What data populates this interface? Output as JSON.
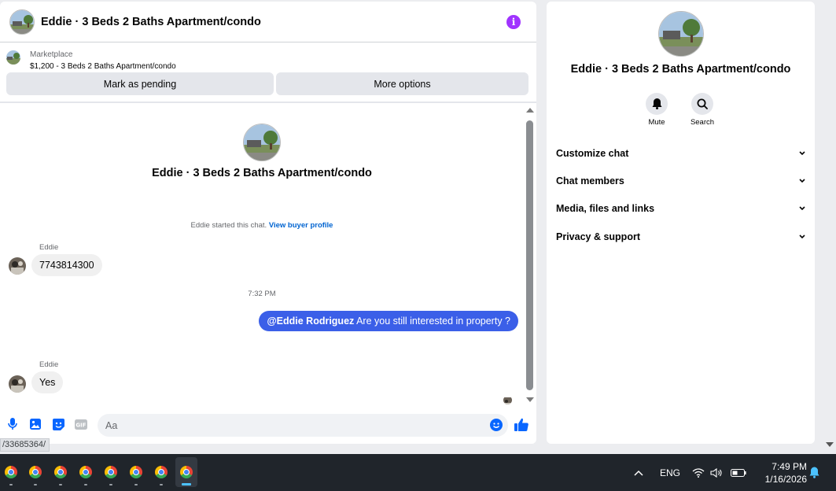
{
  "chat": {
    "title": "Eddie · 3 Beds 2 Baths Apartment/condo",
    "info_icon": "info-icon",
    "listing": {
      "source": "Marketplace",
      "detail": "$1,200 - 3 Beds 2 Baths Apartment/condo"
    },
    "actions": {
      "pending": "Mark as pending",
      "more": "More options"
    },
    "intro": {
      "title": "Eddie · 3 Beds 2 Baths Apartment/condo",
      "note": "Eddie started this chat.",
      "link": "View buyer profile"
    },
    "messages": [
      {
        "sender": "Eddie",
        "text": "7743814300"
      },
      {
        "time": "7:32 PM"
      },
      {
        "mention": "@Eddie Rodriguez",
        "text": " Are you still interested in property ?"
      },
      {
        "sender": "Eddie",
        "text": "Yes"
      }
    ],
    "composer": {
      "placeholder": "Aa"
    }
  },
  "info_panel": {
    "title": "Eddie · 3 Beds 2 Baths Apartment/condo",
    "actions": [
      {
        "label": "Mute",
        "icon": "bell-icon"
      },
      {
        "label": "Search",
        "icon": "search-icon"
      }
    ],
    "sections": [
      {
        "label": "Customize chat"
      },
      {
        "label": "Chat members"
      },
      {
        "label": "Media, files and links"
      },
      {
        "label": "Privacy & support"
      }
    ]
  },
  "status_url": "/33685364/",
  "taskbar": {
    "language": "ENG",
    "time": "7:49 PM",
    "date": "1/16/2026"
  },
  "colors": {
    "accent": "#0064d1",
    "outgoing_bubble": "#3b5fe8",
    "info_button": "#a033ff",
    "like": "#0866ff"
  }
}
